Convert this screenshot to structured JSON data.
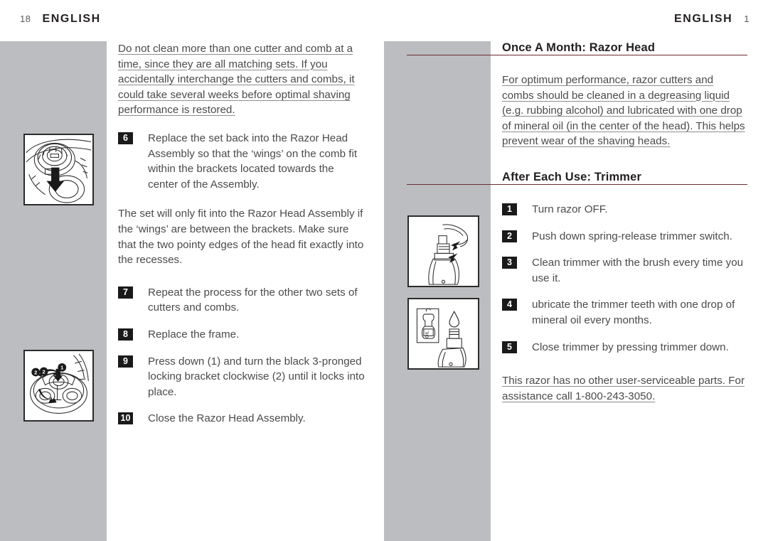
{
  "page": {
    "left_running_head": {
      "folio": "18",
      "title": "ENGLISH"
    },
    "right_running_head": {
      "folio": "1",
      "title": "ENGLISH"
    },
    "accent_rule_color": "#6b2c33",
    "band_color": "#bcbdc0"
  },
  "left_column": {
    "intro_note": "Do not clean more than one cutter and comb at a time, since they are all matching sets. If you accidentally interchange the cutters and combs, it could take several weeks before optimal shaving performance is restored.",
    "steps_a": [
      {
        "number": "6",
        "text": "Replace the set back into the Razor Head Assembly so that the ‘wings’ on the comb fit within the brackets located towards the center of the Assembly."
      }
    ],
    "mid_note": "The set will only fit into the Razor Head Assembly if the ‘wings’ are between the brackets. Make sure that the two pointy edges of the head fit exactly into the recesses.",
    "steps_b": [
      {
        "number": "7",
        "text": "Repeat the process for the other two sets of cutters and combs."
      },
      {
        "number": "8",
        "text": "Replace the frame."
      },
      {
        "number": "9",
        "text": "Press down (1) and turn the black 3-pronged locking bracket clockwise (2) until it locks into place."
      },
      {
        "number": "10",
        "text": "Close the Razor Head Assembly."
      }
    ],
    "illustrations": [
      {
        "name": "razor-head-cutter-insert-illustration",
        "caption_marks": [
          "down-arrow"
        ]
      },
      {
        "name": "locking-bracket-rotate-illustration",
        "caption_marks": [
          "1",
          "2",
          "down-arrow",
          "rotate-arrow"
        ]
      }
    ]
  },
  "right_column": {
    "section_one": {
      "heading": "Once A Month: Razor Head",
      "body": "For optimum performance, razor cutters and combs should be cleaned in a degreasing liquid (e.g. rubbing alcohol) and lubricated with one drop of mineral oil (in the center of the head). This helps prevent wear of the shaving heads."
    },
    "section_two": {
      "heading": "After Each Use: Trimmer",
      "steps": [
        {
          "number": "1",
          "text": "Turn razor OFF."
        },
        {
          "number": "2",
          "text": "Push down spring-release trimmer switch."
        },
        {
          "number": "3",
          "text": "Clean trimmer with the brush every time you use it."
        },
        {
          "number": "4",
          "text": "ubricate the trimmer teeth with one drop of mineral oil every  months."
        },
        {
          "number": "5",
          "text": "Close trimmer by pressing trimmer down."
        }
      ]
    },
    "footer_note": "This razor has no other user-serviceable parts. For assistance call 1-800-243-3050.",
    "illustrations": [
      {
        "name": "trimmer-spring-release-illustration",
        "caption_marks": [
          "push-arrow"
        ]
      },
      {
        "name": "trimmer-oil-drop-illustration",
        "caption_marks": [
          "OIL",
          "oil-drop"
        ]
      }
    ]
  }
}
